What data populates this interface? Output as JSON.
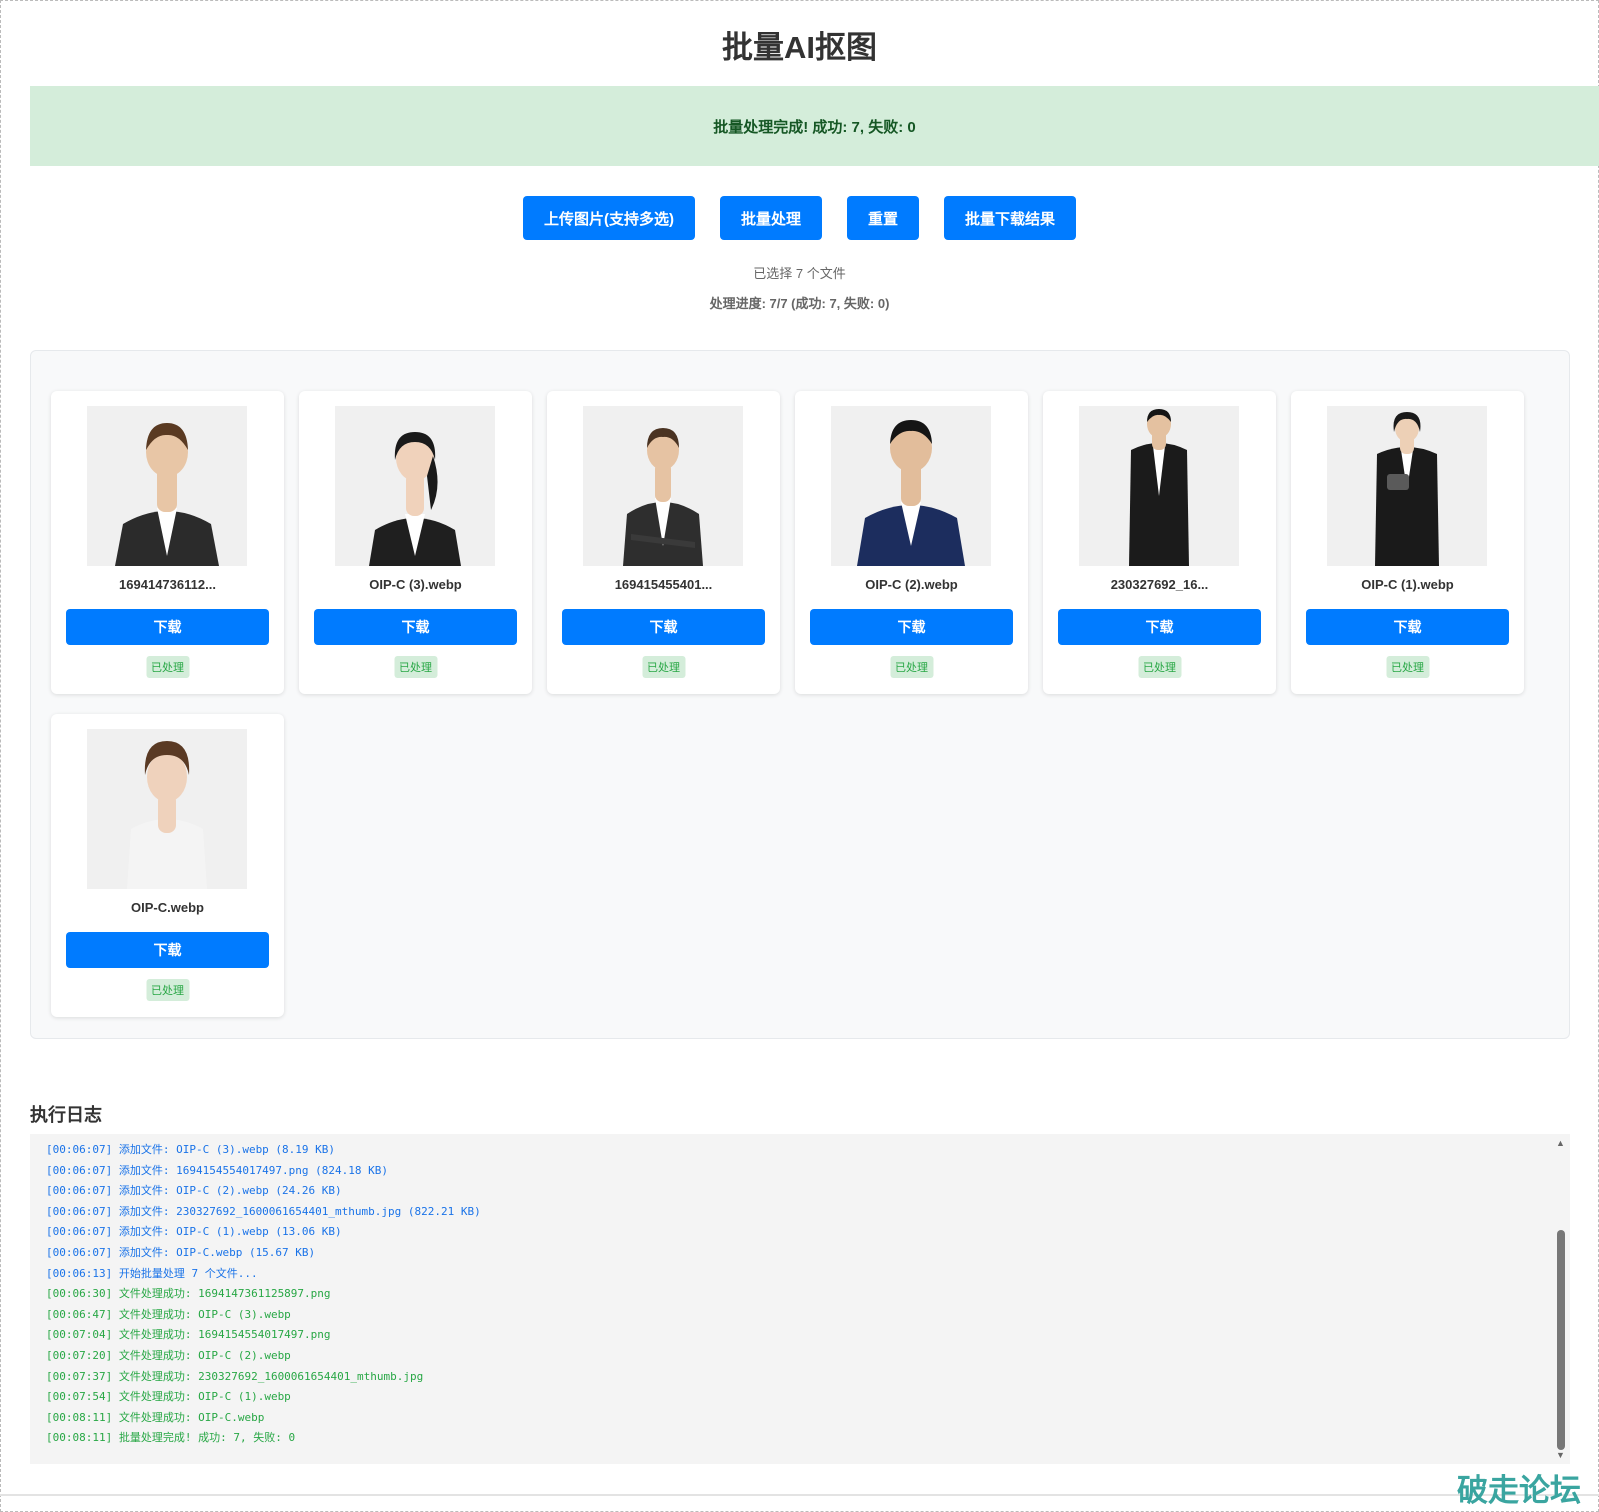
{
  "page": {
    "title": "批量AI抠图"
  },
  "alert": {
    "message": "批量处理完成! 成功: 7, 失败: 0"
  },
  "toolbar": {
    "upload_label": "上传图片(支持多选)",
    "process_label": "批量处理",
    "reset_label": "重置",
    "download_all_label": "批量下载结果"
  },
  "status": {
    "file_count": "已选择 7 个文件",
    "progress": "处理进度: 7/7 (成功: 7, 失败: 0)"
  },
  "results": {
    "download_label": "下载",
    "processed_label": "已处理",
    "items": [
      {
        "name": "169414736112...",
        "suit": "#2b2b2b",
        "hair": "#5a3a22"
      },
      {
        "name": "OIP-C (3).webp",
        "suit": "#1f1f1f",
        "hair": "#1a1a1a"
      },
      {
        "name": "169415455401...",
        "suit": "#2e2e2e",
        "hair": "#4a3322"
      },
      {
        "name": "OIP-C (2).webp",
        "suit": "#1c2d5e",
        "hair": "#151515"
      },
      {
        "name": "230327692_16...",
        "suit": "#1b1b1b",
        "hair": "#151515"
      },
      {
        "name": "OIP-C (1).webp",
        "suit": "#1a1a1a",
        "hair": "#1a1a1a"
      },
      {
        "name": "OIP-C.webp",
        "suit": "#f4f4f4",
        "hair": "#5a3a24"
      }
    ]
  },
  "log": {
    "title": "执行日志",
    "lines": [
      {
        "text": "[00:06:07] 添加文件: OIP-C (3).webp (8.19 KB)",
        "type": "info"
      },
      {
        "text": "[00:06:07] 添加文件: 1694154554017497.png (824.18 KB)",
        "type": "info"
      },
      {
        "text": "[00:06:07] 添加文件: OIP-C (2).webp (24.26 KB)",
        "type": "info"
      },
      {
        "text": "[00:06:07] 添加文件: 230327692_1600061654401_mthumb.jpg (822.21 KB)",
        "type": "info"
      },
      {
        "text": "[00:06:07] 添加文件: OIP-C (1).webp (13.06 KB)",
        "type": "info"
      },
      {
        "text": "[00:06:07] 添加文件: OIP-C.webp (15.67 KB)",
        "type": "info"
      },
      {
        "text": "[00:06:13] 开始批量处理 7 个文件...",
        "type": "info"
      },
      {
        "text": "[00:06:30] 文件处理成功: 1694147361125897.png",
        "type": "ok"
      },
      {
        "text": "[00:06:47] 文件处理成功: OIP-C (3).webp",
        "type": "ok"
      },
      {
        "text": "[00:07:04] 文件处理成功: 1694154554017497.png",
        "type": "ok"
      },
      {
        "text": "[00:07:20] 文件处理成功: OIP-C (2).webp",
        "type": "ok"
      },
      {
        "text": "[00:07:37] 文件处理成功: 230327692_1600061654401_mthumb.jpg",
        "type": "ok"
      },
      {
        "text": "[00:07:54] 文件处理成功: OIP-C (1).webp",
        "type": "ok"
      },
      {
        "text": "[00:08:11] 文件处理成功: OIP-C.webp",
        "type": "ok"
      },
      {
        "text": "[00:08:11] 批量处理完成! 成功: 7, 失败: 0",
        "type": "ok"
      }
    ]
  },
  "watermark": {
    "text": "破走论坛"
  },
  "colors": {
    "primary": "#007bff",
    "success_bg": "#d4edda",
    "success_text": "#155724",
    "log_info": "#1a73e8",
    "log_ok": "#28a745"
  }
}
